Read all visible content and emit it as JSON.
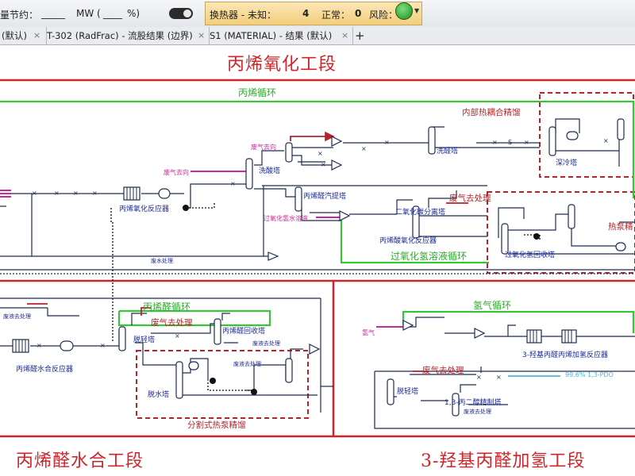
{
  "toolbar": {
    "energy_saving_label": "量节约：",
    "energy_value_blank": "_____",
    "energy_unit": "MW",
    "percent_open": "(",
    "percent_blank": "____",
    "percent_close": "%)",
    "heat_exchanger_label": "换热器 - 未知：",
    "unknown_count": "4",
    "normal_label": "正常：",
    "normal_count": "0",
    "risk_label": "风险：",
    "risk_count": "0"
  },
  "tabs": [
    {
      "label": "(默认)"
    },
    {
      "label": "T-302 (RadFrac) - 流股结果 (边界)"
    },
    {
      "label": "S1 (MATERIAL) - 结果 (默认)"
    }
  ],
  "tab_add": "+",
  "sections": {
    "propylene_oxidation": "丙烯氧化工段",
    "acrolein_hydration": "丙烯醛水合工段",
    "hydrogenation": "3-羟基丙醛加氢工段"
  },
  "green_labels": {
    "propylene_cycle": "丙烯循环",
    "peracetic_cycle": "过氧化氢溶液循环",
    "acrolein_cycle": "丙烯醛循环",
    "hydrogen_cycle": "氢气循环"
  },
  "red_labels": {
    "internal_heat": "内部热耦合精馏",
    "heat_pump": "热泵精",
    "split_heat_pump": "分割式热泵精馏",
    "waste_gas_1": "废气去处理",
    "waste_gas_2": "废气去处理",
    "waste_gas_3": "废气去处理"
  },
  "blue_labels": {
    "propylene_oxidation_reactor": "丙烯氧化反应器",
    "wash_tower": "洗酸塔",
    "wash_tower_2": "洗醛塔",
    "deep_cool_tower": "深冷塔",
    "acrolein_stripper": "丙烯醛汽提塔",
    "co2_separator": "二氧化碳分离塔",
    "acrylic_oxidation_reactor": "丙烯酸氧化反应器",
    "peroxide_recovery": "过氧化氢回收塔",
    "acrolein_recovery": "丙烯醛回收塔",
    "light_removal": "脱轻塔",
    "acrolein_hydration_reactor": "丙烯醛水合反应器",
    "dehydration": "脱水塔",
    "hydroxy_hydrogenation_reactor": "3-羟基丙醛丙烯加氢反应器",
    "light_removal_2": "脱轻塔",
    "propanediol_refining": "1,3-丙二醇精制塔"
  },
  "magenta_labels": {
    "exhaust_1": "废气去向",
    "exhaust_2": "废气去向",
    "peroxide_water": "过氧化氢水溶液",
    "hydrogen": "氢气"
  },
  "small_labels": {
    "waste_water_1": "废水处理",
    "waste_liquid_1": "废液去处理",
    "waste_liquid_2": "废液去处理",
    "waste_liquid_3": "废液去处理",
    "waste_liquid_4": "废液去处理"
  },
  "product_label": "99.6% 1,3-PDO",
  "colors": {
    "section_red": "#d0242b",
    "dashed_red": "#b8232b",
    "cycle_green": "#39c23a",
    "stream_dark": "#1e2a55",
    "stream_red": "#b8232b",
    "magenta": "#c8299b",
    "cyan": "#45b8e0"
  },
  "icons": [
    "toggle-switch-icon",
    "run-go-icon",
    "tab-close-icon",
    "add-tab-icon"
  ]
}
